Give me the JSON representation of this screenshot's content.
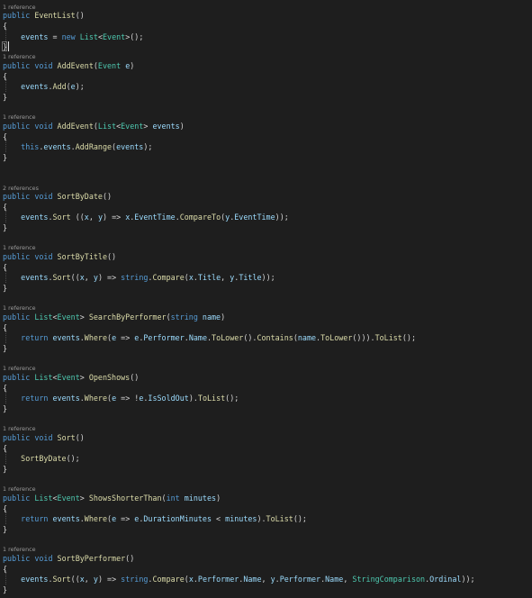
{
  "colors": {
    "background": "#1e1e1e",
    "keyword": "#569cd6",
    "type": "#4ec9b0",
    "method": "#dcdcaa",
    "variable": "#9cdcfe",
    "plain": "#d4d4d4",
    "codelens": "#9a9a9a"
  },
  "codelens": {
    "constructor": "1 reference",
    "add_event": "1 reference",
    "add_range": "1 reference",
    "sort_by_date": "2 references",
    "sort_by_title": "1 reference",
    "search_by_performer": "1 reference",
    "open_shows": "1 reference",
    "sort": "1 reference",
    "shows_shorter_than": "1 reference",
    "sort_by_performer": "1 reference"
  },
  "code_lines": [
    {
      "id": "constructor-signature",
      "tokens": [
        [
          "public",
          "kw"
        ],
        [
          " ",
          "pl"
        ],
        [
          "EventList",
          "fn"
        ],
        [
          "()",
          "pl"
        ]
      ]
    },
    {
      "id": "constructor-open-brace",
      "tokens": [
        [
          "{",
          "pl"
        ]
      ]
    },
    {
      "id": "constructor-body",
      "tokens": [
        [
          "    ",
          "pl"
        ],
        [
          "events",
          "vr"
        ],
        [
          " = ",
          "pl"
        ],
        [
          "new",
          "kw"
        ],
        [
          " ",
          "pl"
        ],
        [
          "List",
          "ty"
        ],
        [
          "<",
          "pl"
        ],
        [
          "Event",
          "ty"
        ],
        [
          ">();",
          "pl"
        ]
      ]
    },
    {
      "id": "constructor-close-brace",
      "tokens": [
        [
          "}",
          "pl"
        ]
      ]
    },
    {
      "id": "add-event-signature",
      "tokens": [
        [
          "public",
          "kw"
        ],
        [
          " ",
          "pl"
        ],
        [
          "void",
          "kw"
        ],
        [
          " ",
          "pl"
        ],
        [
          "AddEvent",
          "fn"
        ],
        [
          "(",
          "pl"
        ],
        [
          "Event",
          "ty"
        ],
        [
          " ",
          "pl"
        ],
        [
          "e",
          "vr"
        ],
        [
          ")",
          "pl"
        ]
      ]
    },
    {
      "id": "add-event-open-brace",
      "tokens": [
        [
          "{",
          "pl"
        ]
      ]
    },
    {
      "id": "add-event-body",
      "tokens": [
        [
          "    ",
          "pl"
        ],
        [
          "events",
          "vr"
        ],
        [
          ".",
          "pl"
        ],
        [
          "Add",
          "fn"
        ],
        [
          "(",
          "pl"
        ],
        [
          "e",
          "vr"
        ],
        [
          ");",
          "pl"
        ]
      ]
    },
    {
      "id": "add-event-close-brace",
      "tokens": [
        [
          "}",
          "pl"
        ]
      ]
    },
    {
      "id": "add-range-signature",
      "tokens": [
        [
          "public",
          "kw"
        ],
        [
          " ",
          "pl"
        ],
        [
          "void",
          "kw"
        ],
        [
          " ",
          "pl"
        ],
        [
          "AddEvent",
          "fn"
        ],
        [
          "(",
          "pl"
        ],
        [
          "List",
          "ty"
        ],
        [
          "<",
          "pl"
        ],
        [
          "Event",
          "ty"
        ],
        [
          "> ",
          "pl"
        ],
        [
          "events",
          "vr"
        ],
        [
          ")",
          "pl"
        ]
      ]
    },
    {
      "id": "add-range-open-brace",
      "tokens": [
        [
          "{",
          "pl"
        ]
      ]
    },
    {
      "id": "add-range-body",
      "tokens": [
        [
          "    ",
          "pl"
        ],
        [
          "this",
          "kw"
        ],
        [
          ".",
          "pl"
        ],
        [
          "events",
          "vr"
        ],
        [
          ".",
          "pl"
        ],
        [
          "AddRange",
          "fn"
        ],
        [
          "(",
          "pl"
        ],
        [
          "events",
          "vr"
        ],
        [
          ");",
          "pl"
        ]
      ]
    },
    {
      "id": "add-range-close-brace",
      "tokens": [
        [
          "}",
          "pl"
        ]
      ]
    },
    {
      "id": "sort-by-date-signature",
      "tokens": [
        [
          "public",
          "kw"
        ],
        [
          " ",
          "pl"
        ],
        [
          "void",
          "kw"
        ],
        [
          " ",
          "pl"
        ],
        [
          "SortByDate",
          "fn"
        ],
        [
          "()",
          "pl"
        ]
      ]
    },
    {
      "id": "sort-by-date-open-brace",
      "tokens": [
        [
          "{",
          "pl"
        ]
      ]
    },
    {
      "id": "sort-by-date-body",
      "tokens": [
        [
          "    ",
          "pl"
        ],
        [
          "events",
          "vr"
        ],
        [
          ".",
          "pl"
        ],
        [
          "Sort",
          "fn"
        ],
        [
          " ((",
          "pl"
        ],
        [
          "x",
          "vr"
        ],
        [
          ", ",
          "pl"
        ],
        [
          "y",
          "vr"
        ],
        [
          ") => ",
          "pl"
        ],
        [
          "x",
          "vr"
        ],
        [
          ".",
          "pl"
        ],
        [
          "EventTime",
          "vr"
        ],
        [
          ".",
          "pl"
        ],
        [
          "CompareTo",
          "fn"
        ],
        [
          "(",
          "pl"
        ],
        [
          "y",
          "vr"
        ],
        [
          ".",
          "pl"
        ],
        [
          "EventTime",
          "vr"
        ],
        [
          "));",
          "pl"
        ]
      ]
    },
    {
      "id": "sort-by-date-close-brace",
      "tokens": [
        [
          "}",
          "pl"
        ]
      ]
    },
    {
      "id": "sort-by-title-signature",
      "tokens": [
        [
          "public",
          "kw"
        ],
        [
          " ",
          "pl"
        ],
        [
          "void",
          "kw"
        ],
        [
          " ",
          "pl"
        ],
        [
          "SortByTitle",
          "fn"
        ],
        [
          "()",
          "pl"
        ]
      ]
    },
    {
      "id": "sort-by-title-open-brace",
      "tokens": [
        [
          "{",
          "pl"
        ]
      ]
    },
    {
      "id": "sort-by-title-body",
      "tokens": [
        [
          "    ",
          "pl"
        ],
        [
          "events",
          "vr"
        ],
        [
          ".",
          "pl"
        ],
        [
          "Sort",
          "fn"
        ],
        [
          "((",
          "pl"
        ],
        [
          "x",
          "vr"
        ],
        [
          ", ",
          "pl"
        ],
        [
          "y",
          "vr"
        ],
        [
          ") => ",
          "pl"
        ],
        [
          "string",
          "kw"
        ],
        [
          ".",
          "pl"
        ],
        [
          "Compare",
          "fn"
        ],
        [
          "(",
          "pl"
        ],
        [
          "x",
          "vr"
        ],
        [
          ".",
          "pl"
        ],
        [
          "Title",
          "vr"
        ],
        [
          ", ",
          "pl"
        ],
        [
          "y",
          "vr"
        ],
        [
          ".",
          "pl"
        ],
        [
          "Title",
          "vr"
        ],
        [
          "));",
          "pl"
        ]
      ]
    },
    {
      "id": "sort-by-title-close-brace",
      "tokens": [
        [
          "}",
          "pl"
        ]
      ]
    },
    {
      "id": "search-by-performer-signature",
      "tokens": [
        [
          "public",
          "kw"
        ],
        [
          " ",
          "pl"
        ],
        [
          "List",
          "ty"
        ],
        [
          "<",
          "pl"
        ],
        [
          "Event",
          "ty"
        ],
        [
          "> ",
          "pl"
        ],
        [
          "SearchByPerformer",
          "fn"
        ],
        [
          "(",
          "pl"
        ],
        [
          "string",
          "kw"
        ],
        [
          " ",
          "pl"
        ],
        [
          "name",
          "vr"
        ],
        [
          ")",
          "pl"
        ]
      ]
    },
    {
      "id": "search-by-performer-open-brace",
      "tokens": [
        [
          "{",
          "pl"
        ]
      ]
    },
    {
      "id": "search-by-performer-body",
      "tokens": [
        [
          "    ",
          "pl"
        ],
        [
          "return",
          "kw"
        ],
        [
          " ",
          "pl"
        ],
        [
          "events",
          "vr"
        ],
        [
          ".",
          "pl"
        ],
        [
          "Where",
          "fn"
        ],
        [
          "(",
          "pl"
        ],
        [
          "e",
          "vr"
        ],
        [
          " => ",
          "pl"
        ],
        [
          "e",
          "vr"
        ],
        [
          ".",
          "pl"
        ],
        [
          "Performer",
          "vr"
        ],
        [
          ".",
          "pl"
        ],
        [
          "Name",
          "vr"
        ],
        [
          ".",
          "pl"
        ],
        [
          "ToLower",
          "fn"
        ],
        [
          "().",
          "pl"
        ],
        [
          "Contains",
          "fn"
        ],
        [
          "(",
          "pl"
        ],
        [
          "name",
          "vr"
        ],
        [
          ".",
          "pl"
        ],
        [
          "ToLower",
          "fn"
        ],
        [
          "())).",
          "pl"
        ],
        [
          "ToList",
          "fn"
        ],
        [
          "();",
          "pl"
        ]
      ]
    },
    {
      "id": "search-by-performer-close-brace",
      "tokens": [
        [
          "}",
          "pl"
        ]
      ]
    },
    {
      "id": "open-shows-signature",
      "tokens": [
        [
          "public",
          "kw"
        ],
        [
          " ",
          "pl"
        ],
        [
          "List",
          "ty"
        ],
        [
          "<",
          "pl"
        ],
        [
          "Event",
          "ty"
        ],
        [
          "> ",
          "pl"
        ],
        [
          "OpenShows",
          "fn"
        ],
        [
          "()",
          "pl"
        ]
      ]
    },
    {
      "id": "open-shows-open-brace",
      "tokens": [
        [
          "{",
          "pl"
        ]
      ]
    },
    {
      "id": "open-shows-body",
      "tokens": [
        [
          "    ",
          "pl"
        ],
        [
          "return",
          "kw"
        ],
        [
          " ",
          "pl"
        ],
        [
          "events",
          "vr"
        ],
        [
          ".",
          "pl"
        ],
        [
          "Where",
          "fn"
        ],
        [
          "(",
          "pl"
        ],
        [
          "e",
          "vr"
        ],
        [
          " => !",
          "pl"
        ],
        [
          "e",
          "vr"
        ],
        [
          ".",
          "pl"
        ],
        [
          "IsSoldOut",
          "vr"
        ],
        [
          ").",
          "pl"
        ],
        [
          "ToList",
          "fn"
        ],
        [
          "();",
          "pl"
        ]
      ]
    },
    {
      "id": "open-shows-close-brace",
      "tokens": [
        [
          "}",
          "pl"
        ]
      ]
    },
    {
      "id": "sort-signature",
      "tokens": [
        [
          "public",
          "kw"
        ],
        [
          " ",
          "pl"
        ],
        [
          "void",
          "kw"
        ],
        [
          " ",
          "pl"
        ],
        [
          "Sort",
          "fn"
        ],
        [
          "()",
          "pl"
        ]
      ]
    },
    {
      "id": "sort-open-brace",
      "tokens": [
        [
          "{",
          "pl"
        ]
      ]
    },
    {
      "id": "sort-body",
      "tokens": [
        [
          "    ",
          "pl"
        ],
        [
          "SortByDate",
          "fn"
        ],
        [
          "();",
          "pl"
        ]
      ]
    },
    {
      "id": "sort-close-brace",
      "tokens": [
        [
          "}",
          "pl"
        ]
      ]
    },
    {
      "id": "shows-shorter-than-signature",
      "tokens": [
        [
          "public",
          "kw"
        ],
        [
          " ",
          "pl"
        ],
        [
          "List",
          "ty"
        ],
        [
          "<",
          "pl"
        ],
        [
          "Event",
          "ty"
        ],
        [
          "> ",
          "pl"
        ],
        [
          "ShowsShorterThan",
          "fn"
        ],
        [
          "(",
          "pl"
        ],
        [
          "int",
          "kw"
        ],
        [
          " ",
          "pl"
        ],
        [
          "minutes",
          "vr"
        ],
        [
          ")",
          "pl"
        ]
      ]
    },
    {
      "id": "shows-shorter-than-open-brace",
      "tokens": [
        [
          "{",
          "pl"
        ]
      ]
    },
    {
      "id": "shows-shorter-than-body",
      "tokens": [
        [
          "    ",
          "pl"
        ],
        [
          "return",
          "kw"
        ],
        [
          " ",
          "pl"
        ],
        [
          "events",
          "vr"
        ],
        [
          ".",
          "pl"
        ],
        [
          "Where",
          "fn"
        ],
        [
          "(",
          "pl"
        ],
        [
          "e",
          "vr"
        ],
        [
          " => ",
          "pl"
        ],
        [
          "e",
          "vr"
        ],
        [
          ".",
          "pl"
        ],
        [
          "DurationMinutes",
          "vr"
        ],
        [
          " < ",
          "pl"
        ],
        [
          "minutes",
          "vr"
        ],
        [
          ").",
          "pl"
        ],
        [
          "ToList",
          "fn"
        ],
        [
          "();",
          "pl"
        ]
      ]
    },
    {
      "id": "shows-shorter-than-close-brace",
      "tokens": [
        [
          "}",
          "pl"
        ]
      ]
    },
    {
      "id": "sort-by-performer-signature",
      "tokens": [
        [
          "public",
          "kw"
        ],
        [
          " ",
          "pl"
        ],
        [
          "void",
          "kw"
        ],
        [
          " ",
          "pl"
        ],
        [
          "SortByPerformer",
          "fn"
        ],
        [
          "()",
          "pl"
        ]
      ]
    },
    {
      "id": "sort-by-performer-open-brace",
      "tokens": [
        [
          "{",
          "pl"
        ]
      ]
    },
    {
      "id": "sort-by-performer-body",
      "tokens": [
        [
          "    ",
          "pl"
        ],
        [
          "events",
          "vr"
        ],
        [
          ".",
          "pl"
        ],
        [
          "Sort",
          "fn"
        ],
        [
          "((",
          "pl"
        ],
        [
          "x",
          "vr"
        ],
        [
          ", ",
          "pl"
        ],
        [
          "y",
          "vr"
        ],
        [
          ") => ",
          "pl"
        ],
        [
          "string",
          "kw"
        ],
        [
          ".",
          "pl"
        ],
        [
          "Compare",
          "fn"
        ],
        [
          "(",
          "pl"
        ],
        [
          "x",
          "vr"
        ],
        [
          ".",
          "pl"
        ],
        [
          "Performer",
          "vr"
        ],
        [
          ".",
          "pl"
        ],
        [
          "Name",
          "vr"
        ],
        [
          ", ",
          "pl"
        ],
        [
          "y",
          "vr"
        ],
        [
          ".",
          "pl"
        ],
        [
          "Performer",
          "vr"
        ],
        [
          ".",
          "pl"
        ],
        [
          "Name",
          "vr"
        ],
        [
          ", ",
          "pl"
        ],
        [
          "StringComparison",
          "ty"
        ],
        [
          ".",
          "pl"
        ],
        [
          "Ordinal",
          "vr"
        ],
        [
          "));",
          "pl"
        ]
      ]
    },
    {
      "id": "sort-by-performer-close-brace",
      "tokens": [
        [
          "}",
          "pl"
        ]
      ]
    }
  ]
}
